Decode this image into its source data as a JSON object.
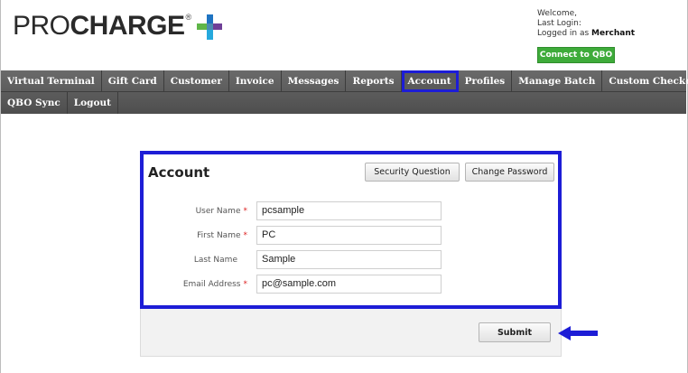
{
  "header": {
    "logo_light": "PRO",
    "logo_bold": "CHARGE",
    "logo_tm": "®",
    "welcome_line": "Welcome,",
    "last_login_label": "Last Login:",
    "logged_in_prefix": "Logged in as",
    "logged_in_user": "Merchant",
    "connect_button": "Connect to QBO"
  },
  "nav": {
    "row1": [
      "Virtual Terminal",
      "Gift Card",
      "Customer",
      "Invoice",
      "Messages",
      "Reports",
      "Account",
      "Profiles",
      "Manage Batch",
      "Custom Checkout"
    ],
    "row2": [
      "QBO Sync",
      "Logout"
    ],
    "active": "Account"
  },
  "account": {
    "title": "Account",
    "security_button": "Security Question",
    "password_button": "Change Password",
    "fields": [
      {
        "label": "User Name",
        "required": true,
        "value": "pcsample"
      },
      {
        "label": "First Name",
        "required": true,
        "value": "PC"
      },
      {
        "label": "Last Name",
        "required": false,
        "value": "Sample"
      },
      {
        "label": "Email Address",
        "required": true,
        "value": "pc@sample.com"
      }
    ],
    "submit_button": "Submit"
  },
  "colors": {
    "highlight": "#1d1dd6",
    "connect_green": "#3eab3a",
    "nav_bg": "#5a5a5a",
    "required": "#dd2222"
  },
  "icons": {
    "logo_mark": "plus-logo-icon",
    "pointer": "arrow-left-icon"
  }
}
